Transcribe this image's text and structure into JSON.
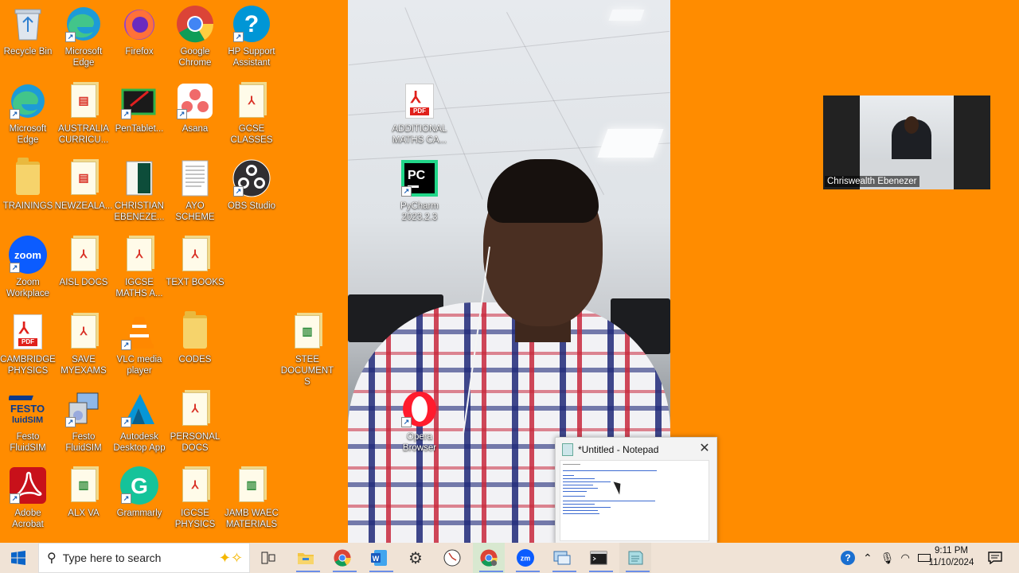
{
  "desktop_icons": [
    {
      "id": "recycle-bin",
      "label": "Recycle Bin",
      "icon": "recycle-bin-icon"
    },
    {
      "id": "edge-1",
      "label": "Microsoft Edge",
      "icon": "edge-icon"
    },
    {
      "id": "firefox",
      "label": "Firefox",
      "icon": "firefox-icon"
    },
    {
      "id": "chrome",
      "label": "Google Chrome",
      "icon": "chrome-icon"
    },
    {
      "id": "hp-support",
      "label": "HP Support Assistant",
      "icon": "help-icon"
    },
    {
      "id": "edge-2",
      "label": "Microsoft Edge",
      "icon": "edge-icon"
    },
    {
      "id": "australia",
      "label": "AUSTRALIA CURRICU...",
      "icon": "document-icon"
    },
    {
      "id": "pentablet",
      "label": "PenTablet...",
      "icon": "pentablet-icon"
    },
    {
      "id": "asana",
      "label": "Asana",
      "icon": "asana-icon"
    },
    {
      "id": "gcse-classes",
      "label": "GCSE CLASSES",
      "icon": "pdf-document-icon"
    },
    {
      "id": "trainings",
      "label": "TRAININGS",
      "icon": "folder-icon"
    },
    {
      "id": "newzeala",
      "label": "NEWZEALA...",
      "icon": "document-icon"
    },
    {
      "id": "christian",
      "label": "CHRISTIAN EBENEZE...",
      "icon": "book-icon"
    },
    {
      "id": "ayo-scheme",
      "label": "AYO SCHEME",
      "icon": "text-document-icon"
    },
    {
      "id": "obs",
      "label": "OBS Studio",
      "icon": "obs-icon"
    },
    {
      "id": "zoom",
      "label": "Zoom Workplace",
      "icon": "zoom-icon"
    },
    {
      "id": "aisl-docs",
      "label": "AISL DOCS",
      "icon": "pdf-document-icon"
    },
    {
      "id": "igcse-maths",
      "label": "IGCSE MATHS A...",
      "icon": "pdf-document-icon"
    },
    {
      "id": "text-books",
      "label": "TEXT BOOKS",
      "icon": "pdf-document-icon"
    },
    {
      "id": "cambridge-physics",
      "label": "CAMBRIDGE PHYSICS",
      "icon": "pdf-icon"
    },
    {
      "id": "save-myexams",
      "label": "SAVE MYEXAMS",
      "icon": "pdf-document-icon"
    },
    {
      "id": "vlc",
      "label": "VLC media player",
      "icon": "vlc-icon"
    },
    {
      "id": "codes",
      "label": "CODES",
      "icon": "folder-icon"
    },
    {
      "id": "stee-documents",
      "label": "STEE DOCUMENTS",
      "icon": "document-icon"
    },
    {
      "id": "festo-1",
      "label": "Festo FluidSIM",
      "icon": "festo-icon"
    },
    {
      "id": "festo-2",
      "label": "Festo FluidSIM",
      "icon": "installer-icon"
    },
    {
      "id": "autodesk",
      "label": "Autodesk Desktop App",
      "icon": "autodesk-icon"
    },
    {
      "id": "personal-docs",
      "label": "PERSONAL DOCS",
      "icon": "document-icon"
    },
    {
      "id": "adobe",
      "label": "Adobe Acrobat",
      "icon": "acrobat-icon"
    },
    {
      "id": "alx-va",
      "label": "ALX VA",
      "icon": "document-icon"
    },
    {
      "id": "grammarly",
      "label": "Grammarly",
      "icon": "grammarly-icon"
    },
    {
      "id": "igcse-physics",
      "label": "IGCSE PHYSICS",
      "icon": "pdf-document-icon"
    },
    {
      "id": "jamb-waec",
      "label": "JAMB WAEC MATERIALS",
      "icon": "document-icon"
    }
  ],
  "video_icons": [
    {
      "label": "ADDITIONAL MATHS CA...",
      "icon": "pdf-icon"
    },
    {
      "label": "PyCharm 2023.2.3",
      "icon": "pycharm-icon"
    },
    {
      "label": "Opera Browser",
      "icon": "opera-icon"
    }
  ],
  "thumbnail": {
    "name": "Chriswealth Ebenezer"
  },
  "notepad_preview": {
    "title": "*Untitled - Notepad",
    "close_icon": "close-icon"
  },
  "taskbar": {
    "search_placeholder": "Type here to search",
    "apps": [
      "task-view-icon",
      "file-explorer-icon",
      "chrome-icon",
      "word-icon",
      "settings-icon",
      "clock-app-icon",
      "chrome-profile-icon",
      "zoom-icon",
      "remote-desktop-icon",
      "terminal-icon",
      "notepad-icon"
    ],
    "time": "9:11 PM",
    "date": "11/10/2024"
  },
  "colors": {
    "desktop_bg": "#ff8c00",
    "taskbar_bg": "#f0e3d6"
  }
}
